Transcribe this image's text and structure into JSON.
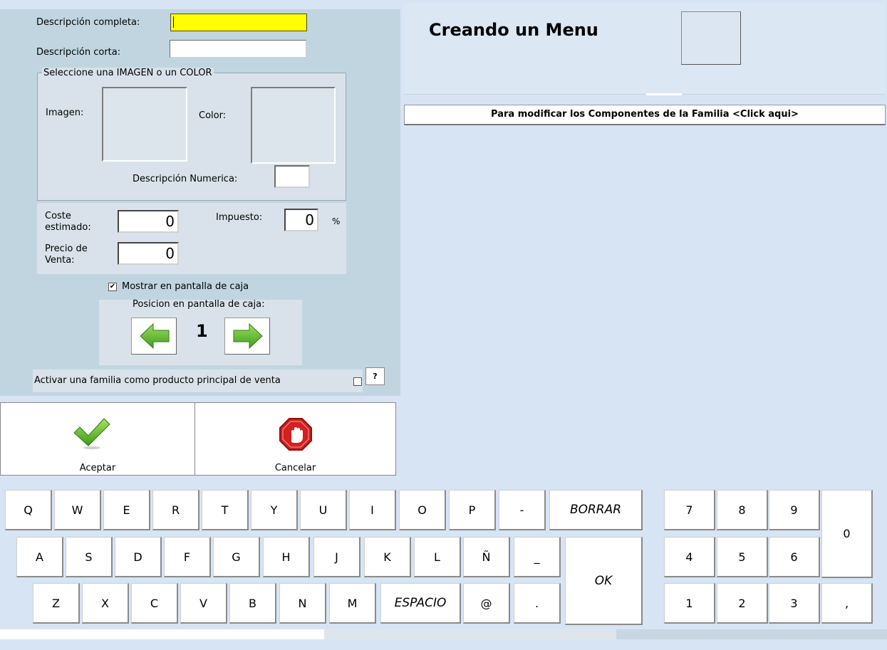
{
  "form": {
    "desc_full_label": "Descripción completa:",
    "desc_full_value": "",
    "desc_short_label": "Descripción corta:",
    "desc_short_value": "",
    "image_group_title": "Seleccione una IMAGEN o un COLOR",
    "image_label": "Imagen:",
    "color_label": "Color:",
    "numeric_desc_label": "Descripción Numerica:",
    "numeric_desc_value": "",
    "cost_label_1": "Coste",
    "cost_label_2": "estimado:",
    "cost_value": "0",
    "tax_label": "Impuesto:",
    "tax_value": "0",
    "tax_unit": "%",
    "price_label_1": "Precio de",
    "price_label_2": "Venta:",
    "price_value": "0",
    "show_on_pos_label": "Mostrar en pantalla de caja",
    "show_on_pos_checked": true,
    "position_label": "Posicion en pantalla de caja:",
    "position_value": "1",
    "feature_label": "Activar una familia como producto principal de venta",
    "feature_checked": false,
    "help_label": "?"
  },
  "actions": {
    "accept_label": "Aceptar",
    "cancel_label": "Cancelar"
  },
  "header": {
    "title": "Creando un Menu",
    "components_link": "Para modificar los Componentes de la Familia <Click aqui>"
  },
  "keyboard": {
    "row1": [
      "Q",
      "W",
      "E",
      "R",
      "T",
      "Y",
      "U",
      "I",
      "O",
      "P",
      "-"
    ],
    "backspace": "BORRAR",
    "row2": [
      "A",
      "S",
      "D",
      "F",
      "G",
      "H",
      "J",
      "K",
      "L",
      "Ñ",
      "_"
    ],
    "ok": "OK",
    "row3": [
      "Z",
      "X",
      "C",
      "V",
      "B",
      "N",
      "M"
    ],
    "space": "ESPACIO",
    "row3_tail": [
      "@",
      "."
    ],
    "numpad": {
      "row1": [
        "7",
        "8",
        "9"
      ],
      "row2": [
        "4",
        "5",
        "6"
      ],
      "row3": [
        "1",
        "2",
        "3"
      ],
      "zero": "0",
      "comma": ","
    }
  },
  "icons": {
    "accept": "green-checkmark-icon",
    "cancel": "red-stop-hand-icon",
    "left": "green-arrow-left-icon",
    "right": "green-arrow-right-icon"
  },
  "colors": {
    "active_field": "#ffff00",
    "panel": "#c1d5e1",
    "background": "#d7e4f4"
  }
}
